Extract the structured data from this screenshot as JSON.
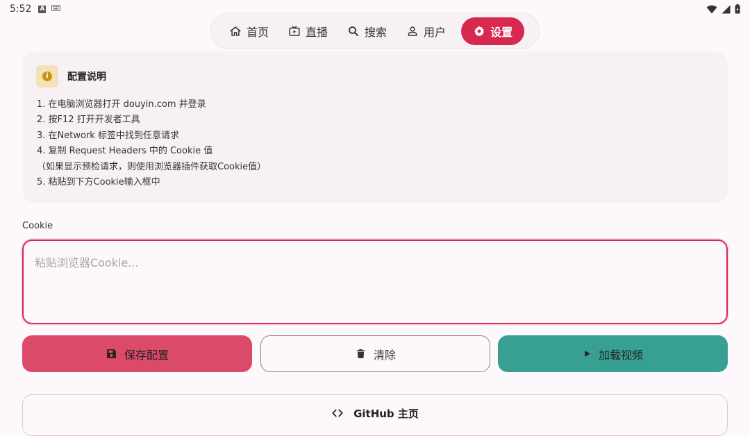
{
  "status_bar": {
    "time": "5:52"
  },
  "nav": {
    "items": [
      {
        "label": "首页",
        "icon": "home-icon"
      },
      {
        "label": "直播",
        "icon": "live-tv-icon"
      },
      {
        "label": "搜索",
        "icon": "search-icon"
      },
      {
        "label": "用户",
        "icon": "user-icon"
      },
      {
        "label": "设置",
        "icon": "gear-icon",
        "active": true
      }
    ]
  },
  "info": {
    "title": "配置说明",
    "badge": "i",
    "lines": [
      "1. 在电脑浏览器打开 douyin.com 并登录",
      "2. 按F12 打开开发者工具",
      "3. 在Network 标签中找到任意请求",
      "4. 复制 Request Headers 中的 Cookie 值",
      "（如果显示预检请求，则使用浏览器插件获取Cookie值）",
      "5. 粘贴到下方Cookie输入框中"
    ]
  },
  "cookie": {
    "label": "Cookie",
    "value": "",
    "placeholder": "粘贴浏览器Cookie..."
  },
  "actions": {
    "save_label": "保存配置",
    "clear_label": "清除",
    "load_label": "加载视频"
  },
  "github": {
    "label": "GitHub 主页"
  },
  "colors": {
    "accent": "#d7284e",
    "save": "#db4a69",
    "load": "#38a092",
    "background": "#fdf8fb"
  }
}
